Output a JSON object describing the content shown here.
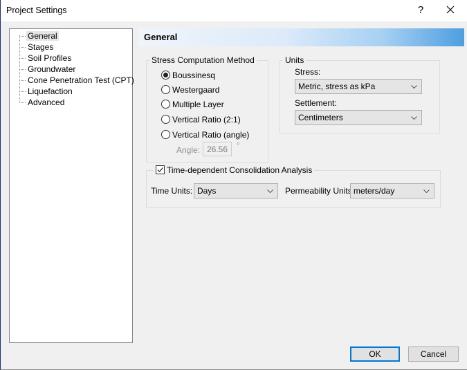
{
  "window": {
    "title": "Project Settings",
    "help_label": "?",
    "close_label": "✕"
  },
  "tree": {
    "selected": "General",
    "items": [
      {
        "label": "General"
      },
      {
        "label": "Stages"
      },
      {
        "label": "Soil Profiles"
      },
      {
        "label": "Groundwater"
      },
      {
        "label": "Cone Penetration Test (CPT)"
      },
      {
        "label": "Liquefaction"
      },
      {
        "label": "Advanced"
      }
    ]
  },
  "header": {
    "title": "General",
    "gradient_colors": [
      "#f0f5fb",
      "#dceafa",
      "#a6d0f2",
      "#4e9ee0"
    ]
  },
  "stress_method": {
    "legend": "Stress Computation Method",
    "selected": "Boussinesq",
    "options": [
      {
        "label": "Boussinesq",
        "checked": true
      },
      {
        "label": "Westergaard",
        "checked": false
      },
      {
        "label": "Multiple Layer",
        "checked": false
      },
      {
        "label": "Vertical Ratio (2:1)",
        "checked": false
      },
      {
        "label": "Vertical Ratio (angle)",
        "checked": false
      }
    ],
    "angle_label": "Angle:",
    "angle_value": "26.56",
    "angle_unit": "°"
  },
  "units": {
    "legend": "Units",
    "stress_label": "Stress:",
    "stress_value": "Metric, stress as kPa",
    "settlement_label": "Settlement:",
    "settlement_value": "Centimeters"
  },
  "consolidation": {
    "checkbox_label": "Time-dependent Consolidation Analysis",
    "checked": true,
    "time_units_label": "Time Units:",
    "time_units_value": "Days",
    "permeability_label": "Permeability Units",
    "permeability_value": "meters/day"
  },
  "buttons": {
    "ok": "OK",
    "cancel": "Cancel"
  },
  "colors": {
    "accent": "#0078d7",
    "window_border": "#1e2a7a"
  }
}
